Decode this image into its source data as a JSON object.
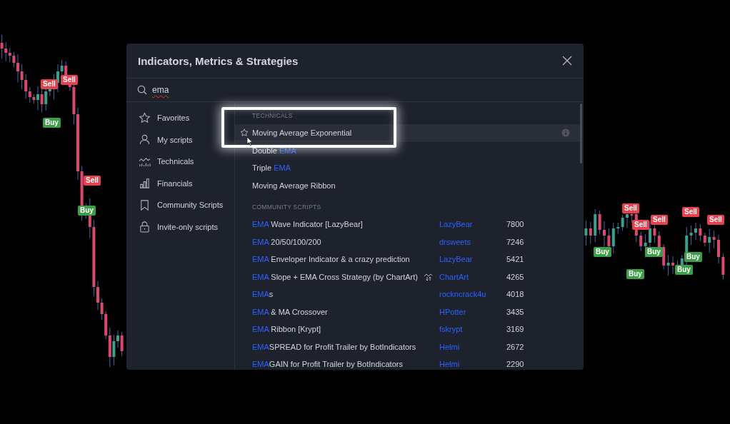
{
  "chart": {
    "signals": [
      {
        "text": "Sell",
        "kind": "sell"
      },
      {
        "text": "Sell",
        "kind": "sell"
      },
      {
        "text": "Buy",
        "kind": "buy"
      },
      {
        "text": "Sell",
        "kind": "sell"
      },
      {
        "text": "Buy",
        "kind": "buy"
      },
      {
        "text": "Sell",
        "kind": "sell"
      },
      {
        "text": "Sell",
        "kind": "sell"
      },
      {
        "text": "Sell",
        "kind": "sell"
      },
      {
        "text": "Sell",
        "kind": "sell"
      },
      {
        "text": "Sell",
        "kind": "sell"
      },
      {
        "text": "Buy",
        "kind": "buy"
      },
      {
        "text": "Buy",
        "kind": "buy"
      },
      {
        "text": "Buy",
        "kind": "buy"
      },
      {
        "text": "Buy",
        "kind": "buy"
      },
      {
        "text": "Buy",
        "kind": "buy"
      }
    ]
  },
  "dialog": {
    "title": "Indicators, Metrics & Strategies",
    "search": {
      "value": "ema"
    },
    "sidebar": {
      "items": [
        {
          "label": "Favorites",
          "selected": false
        },
        {
          "label": "My scripts",
          "selected": false
        },
        {
          "label": "Technicals",
          "selected": false
        },
        {
          "label": "Financials",
          "selected": false
        },
        {
          "label": "Community Scripts",
          "selected": false
        },
        {
          "label": "Invite-only scripts",
          "selected": false
        }
      ]
    },
    "results": {
      "sections": [
        {
          "heading": "TECHNICALS",
          "rows": [
            {
              "name_parts": [
                {
                  "text": "Moving Average Exponential",
                  "match": false
                }
              ],
              "hovered": true
            },
            {
              "name_parts": [
                {
                  "text": "Double ",
                  "match": false
                },
                {
                  "text": "EMA",
                  "match": true
                }
              ],
              "hovered": false
            },
            {
              "name_parts": [
                {
                  "text": "Triple ",
                  "match": false
                },
                {
                  "text": "EMA",
                  "match": true
                }
              ],
              "hovered": false
            },
            {
              "name_parts": [
                {
                  "text": "Moving Average Ribbon",
                  "match": false
                }
              ],
              "hovered": false
            }
          ]
        },
        {
          "heading": "COMMUNITY SCRIPTS",
          "rows": [
            {
              "name_parts": [
                {
                  "text": "EMA",
                  "match": true
                },
                {
                  "text": " Wave Indicator [LazyBear]",
                  "match": false
                }
              ],
              "hovered": false,
              "strategy": false,
              "author": "LazyBear",
              "count": "7800"
            },
            {
              "name_parts": [
                {
                  "text": "EMA",
                  "match": true
                },
                {
                  "text": " 20/50/100/200",
                  "match": false
                }
              ],
              "hovered": false,
              "strategy": false,
              "author": "drsweets",
              "count": "7246"
            },
            {
              "name_parts": [
                {
                  "text": "EMA",
                  "match": true
                },
                {
                  "text": " Enveloper Indicator & a crazy prediction",
                  "match": false
                }
              ],
              "hovered": false,
              "strategy": false,
              "author": "LazyBear",
              "count": "5421"
            },
            {
              "name_parts": [
                {
                  "text": "EMA",
                  "match": true
                },
                {
                  "text": " Slope + EMA Cross Strategy (by ChartArt)",
                  "match": false
                }
              ],
              "hovered": false,
              "strategy": true,
              "author": "ChartArt",
              "count": "4265"
            },
            {
              "name_parts": [
                {
                  "text": "EMA",
                  "match": true
                },
                {
                  "text": "s",
                  "match": false
                }
              ],
              "hovered": false,
              "strategy": false,
              "author": "rockncrack4u",
              "count": "4018"
            },
            {
              "name_parts": [
                {
                  "text": "EMA",
                  "match": true
                },
                {
                  "text": " & MA Crossover",
                  "match": false
                }
              ],
              "hovered": false,
              "strategy": false,
              "author": "HPotter",
              "count": "3435"
            },
            {
              "name_parts": [
                {
                  "text": "EMA",
                  "match": true
                },
                {
                  "text": " Ribbon [Krypt]",
                  "match": false
                }
              ],
              "hovered": false,
              "strategy": false,
              "author": "fskrypt",
              "count": "3169"
            },
            {
              "name_parts": [
                {
                  "text": "EMA",
                  "match": true
                },
                {
                  "text": "SPREAD for Profit Trailer by BotIndicators",
                  "match": false
                }
              ],
              "hovered": false,
              "strategy": false,
              "author": "Helmi",
              "count": "2672"
            },
            {
              "name_parts": [
                {
                  "text": "EMA",
                  "match": true
                },
                {
                  "text": "GAIN for Profit Trailer by BotIndicators",
                  "match": false
                }
              ],
              "hovered": false,
              "strategy": false,
              "author": "Helmi",
              "count": "2290"
            }
          ]
        }
      ]
    }
  }
}
